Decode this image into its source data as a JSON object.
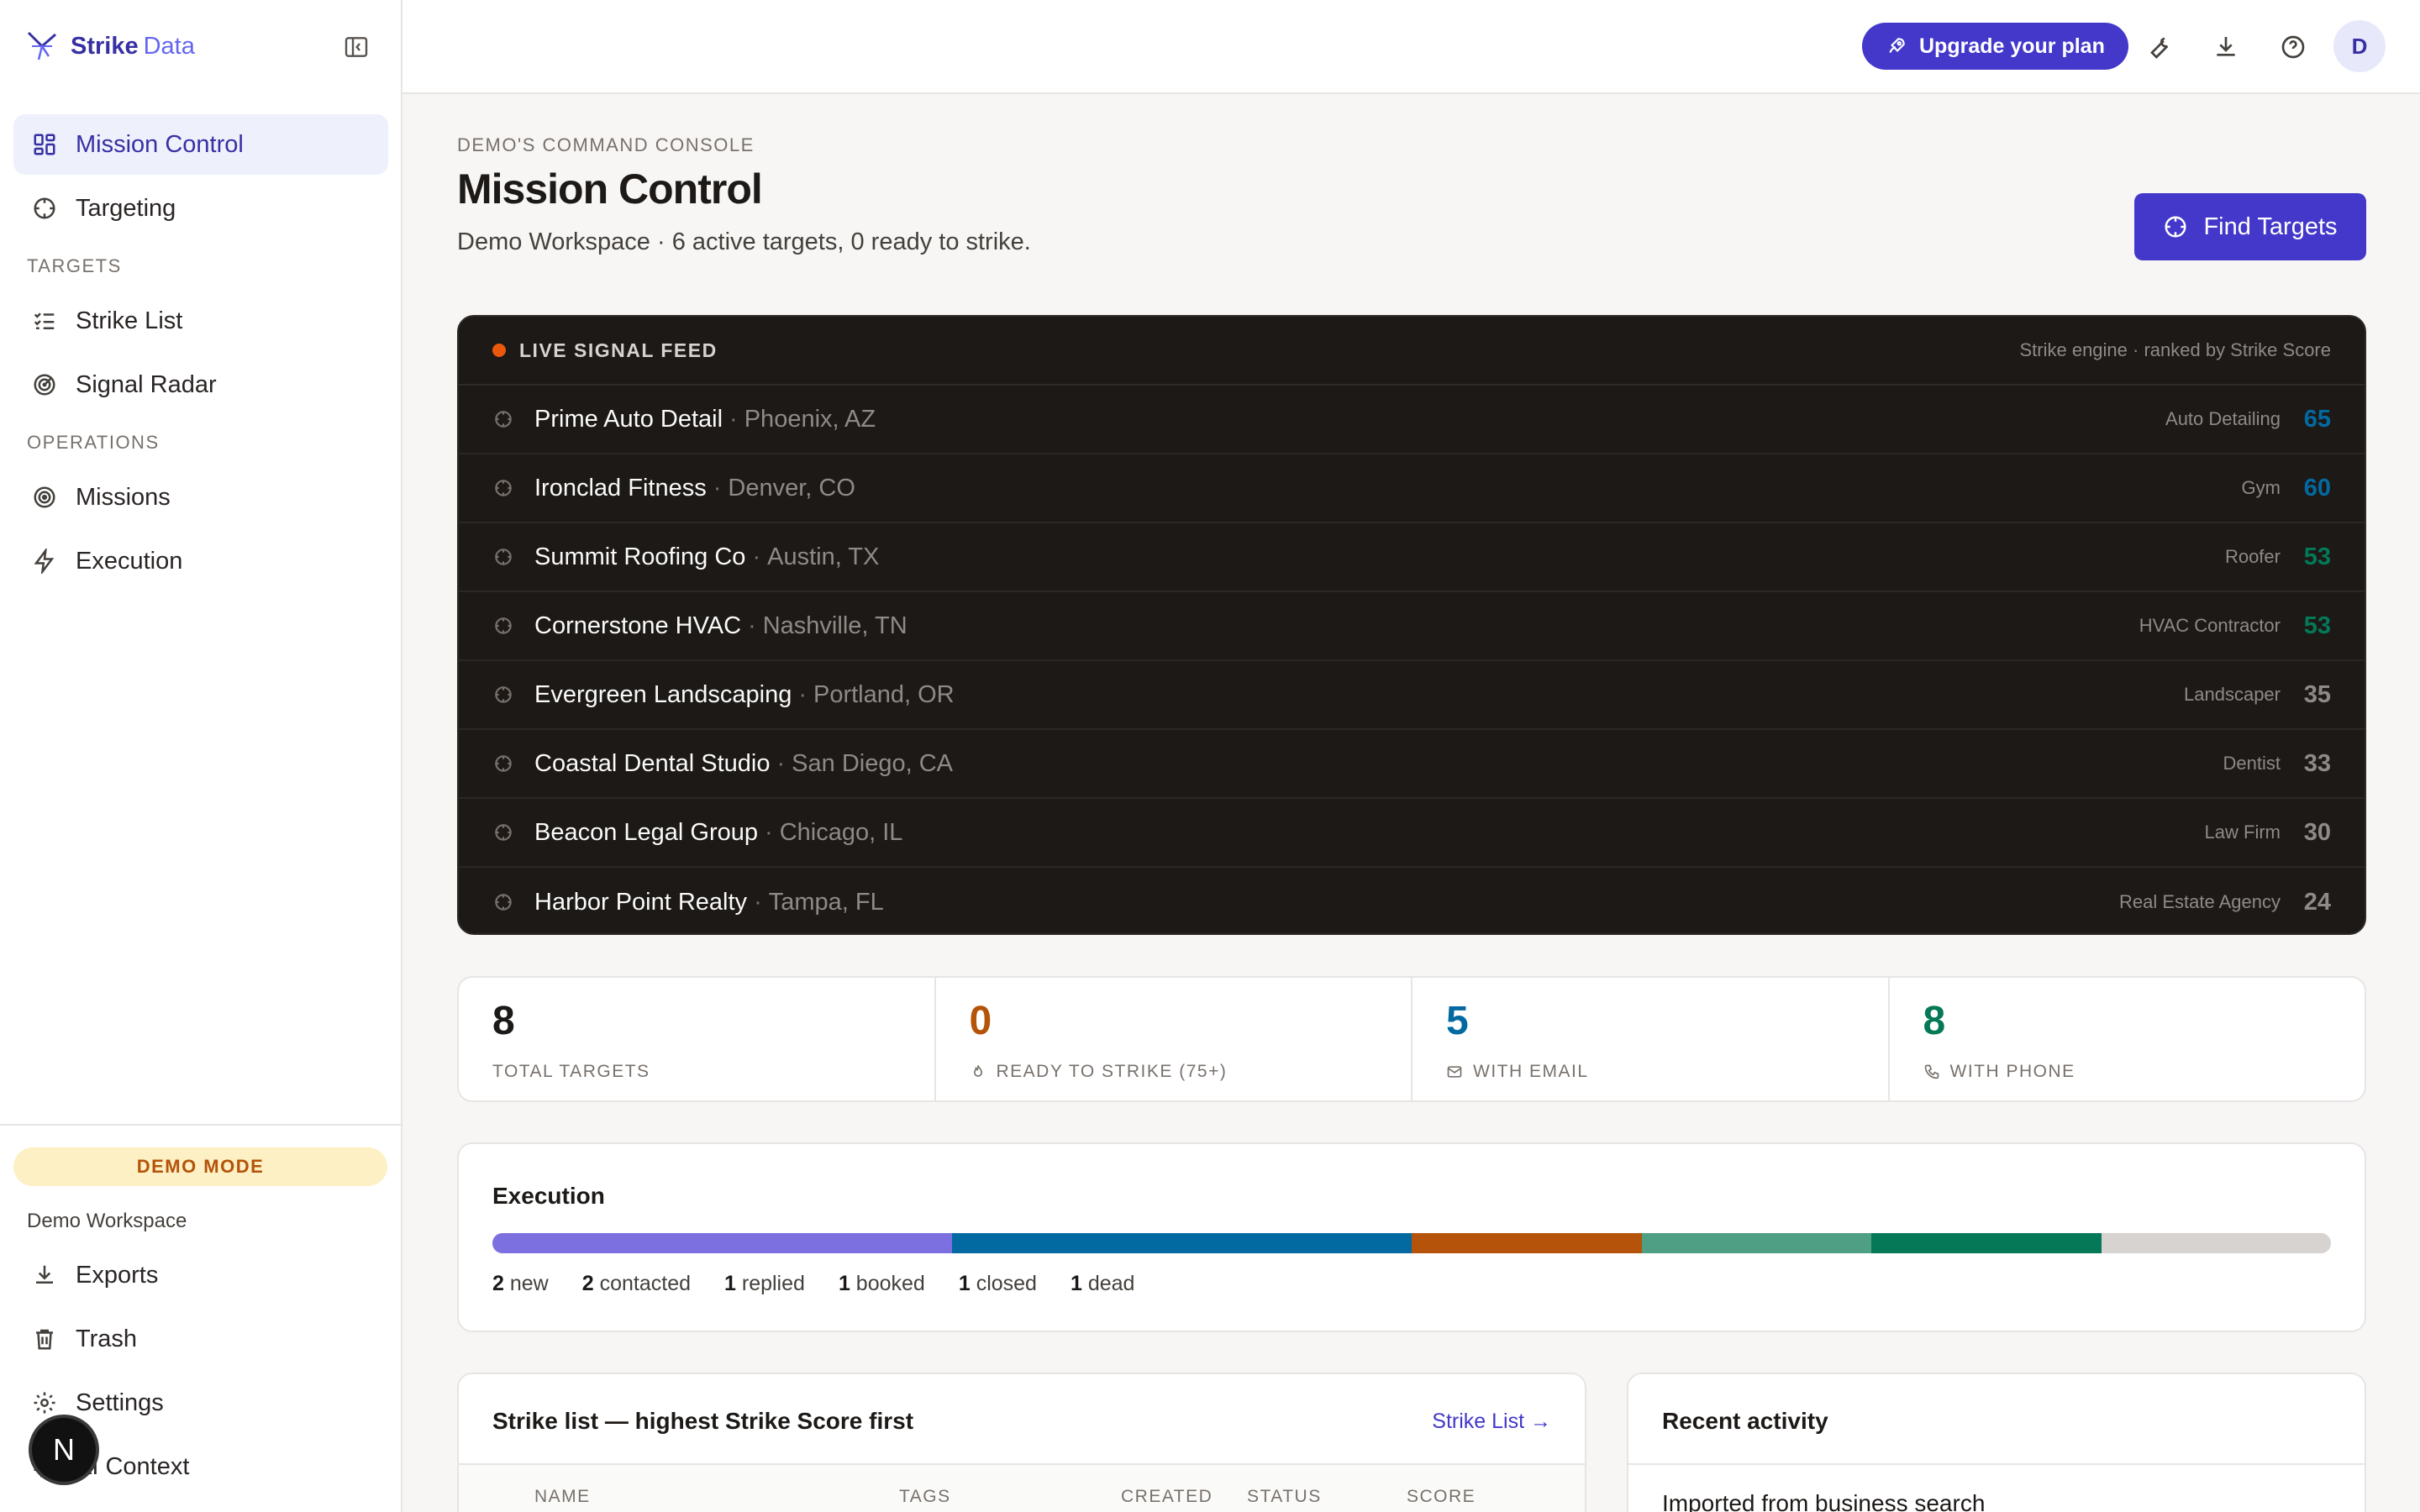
{
  "brand": {
    "name": "Strike",
    "sub": "Data"
  },
  "sidebar": {
    "items_top": [
      {
        "label": "Mission Control",
        "icon": "grid-icon",
        "active": true
      },
      {
        "label": "Targeting",
        "icon": "crosshair-icon"
      }
    ],
    "section_targets": "TARGETS",
    "items_targets": [
      {
        "label": "Strike List",
        "icon": "list-check-icon"
      },
      {
        "label": "Signal Radar",
        "icon": "radar-icon"
      }
    ],
    "section_operations": "OPERATIONS",
    "items_operations": [
      {
        "label": "Missions",
        "icon": "target-icon"
      },
      {
        "label": "Execution",
        "icon": "bolt-icon"
      }
    ],
    "demo_mode": "DEMO MODE",
    "workspace": "Demo Workspace",
    "items_bottom": [
      {
        "label": "Exports",
        "icon": "download-icon"
      },
      {
        "label": "Trash",
        "icon": "trash-icon"
      },
      {
        "label": "Settings",
        "icon": "gear-icon"
      },
      {
        "label": "AI Context",
        "icon": "chip-icon"
      }
    ],
    "badge": "N"
  },
  "header": {
    "upgrade_label": "Upgrade your plan",
    "avatar": "D"
  },
  "main": {
    "kicker": "DEMO'S COMMAND CONSOLE",
    "title": "Mission Control",
    "subtitle": "Demo Workspace · 6 active targets, 0 ready to strike.",
    "find_label": "Find Targets"
  },
  "feed": {
    "label": "LIVE SIGNAL FEED",
    "engine": "Strike engine · ranked by Strike Score",
    "rows": [
      {
        "name": "Prime Auto Detail",
        "loc": "Phoenix, AZ",
        "cat": "Auto Detailing",
        "score": "65",
        "color": "#0369a1"
      },
      {
        "name": "Ironclad Fitness",
        "loc": "Denver, CO",
        "cat": "Gym",
        "score": "60",
        "color": "#0369a1"
      },
      {
        "name": "Summit Roofing Co",
        "loc": "Austin, TX",
        "cat": "Roofer",
        "score": "53",
        "color": "#047857"
      },
      {
        "name": "Cornerstone HVAC",
        "loc": "Nashville, TN",
        "cat": "HVAC Contractor",
        "score": "53",
        "color": "#047857"
      },
      {
        "name": "Evergreen Landscaping",
        "loc": "Portland, OR",
        "cat": "Landscaper",
        "score": "35",
        "color": "#8f8a86"
      },
      {
        "name": "Coastal Dental Studio",
        "loc": "San Diego, CA",
        "cat": "Dentist",
        "score": "33",
        "color": "#8f8a86"
      },
      {
        "name": "Beacon Legal Group",
        "loc": "Chicago, IL",
        "cat": "Law Firm",
        "score": "30",
        "color": "#8f8a86"
      },
      {
        "name": "Harbor Point Realty",
        "loc": "Tampa, FL",
        "cat": "Real Estate Agency",
        "score": "24",
        "color": "#8f8a86"
      }
    ]
  },
  "stats": [
    {
      "value": "8",
      "label": "TOTAL TARGETS",
      "color": "#1c1917",
      "icon": ""
    },
    {
      "value": "0",
      "label": "READY TO STRIKE (75+)",
      "color": "#b45309",
      "icon": "flame-icon"
    },
    {
      "value": "5",
      "label": "WITH EMAIL",
      "color": "#0369a1",
      "icon": "mail-icon"
    },
    {
      "value": "8",
      "label": "WITH PHONE",
      "color": "#047857",
      "icon": "phone-icon"
    }
  ],
  "execution": {
    "title": "Execution",
    "segments": [
      {
        "count": "2",
        "label": "new",
        "color": "#7c6fe0"
      },
      {
        "count": "2",
        "label": "contacted",
        "color": "#0369a1"
      },
      {
        "count": "1",
        "label": "replied",
        "color": "#b45309"
      },
      {
        "count": "1",
        "label": "booked",
        "color": "#4f9f85"
      },
      {
        "count": "1",
        "label": "closed",
        "color": "#047857"
      },
      {
        "count": "1",
        "label": "dead",
        "color": "#d6d3d1"
      }
    ]
  },
  "strike_list": {
    "title": "Strike list — highest Strike Score first",
    "link": "Strike List →",
    "columns": [
      "NAME",
      "TAGS",
      "CREATED",
      "STATUS",
      "SCORE"
    ]
  },
  "activity": {
    "title": "Recent activity",
    "first_item": "Imported from business search"
  }
}
